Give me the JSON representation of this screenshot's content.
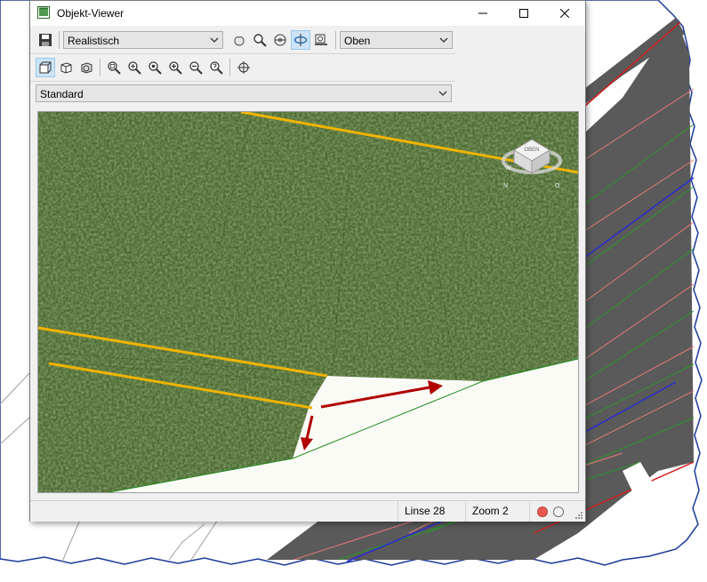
{
  "window": {
    "title": "Objekt-Viewer"
  },
  "toolbar": {
    "visual_style": "Realistisch",
    "view_direction": "Oben",
    "view_preset": "Standard"
  },
  "viewcube": {
    "face_label": "OBEN",
    "compass_west": "W",
    "compass_north": "N",
    "compass_east": "O"
  },
  "statusbar": {
    "lens": "Linse 28",
    "zoom": "Zoom 2"
  },
  "colors": {
    "alignment_lines": "#f0b400",
    "arrows": "#b00000",
    "boundary": "#1f8a1f",
    "status_red": "#e8584e"
  }
}
